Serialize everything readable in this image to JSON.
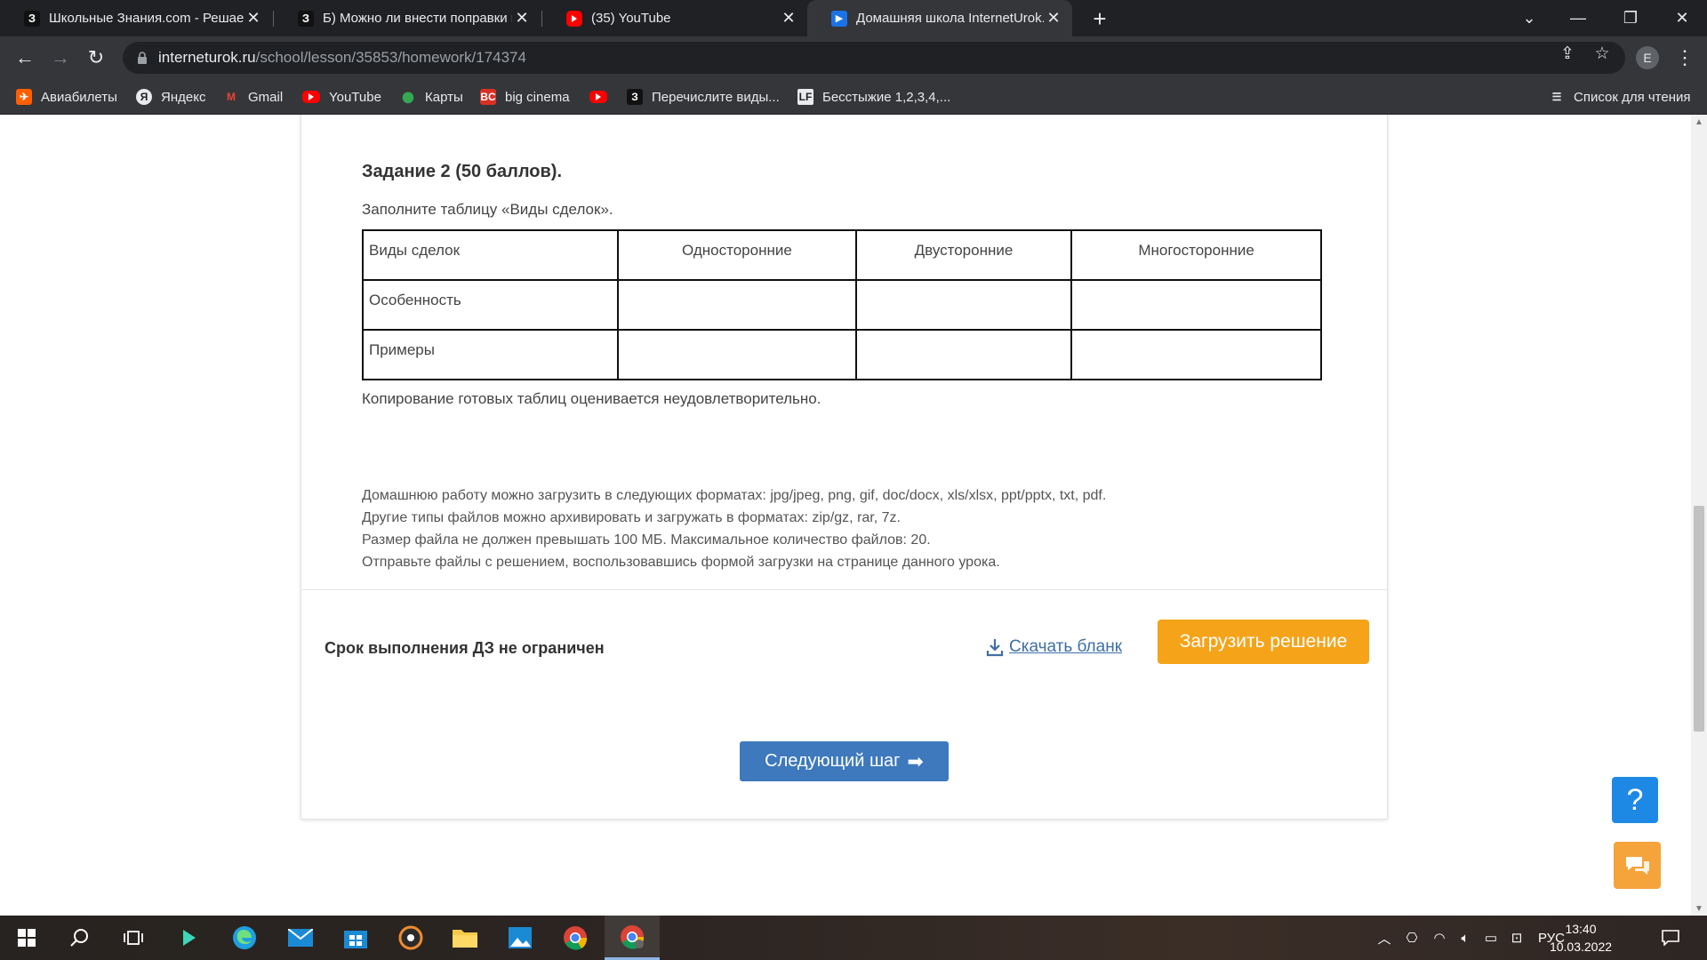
{
  "browser": {
    "tabs": [
      {
        "title": "Школьные Знания.com - Решае",
        "favicon": "znaniya-icon"
      },
      {
        "title": "Б) Можно ли внести поправки в",
        "favicon": "znaniya-icon"
      },
      {
        "title": "(35) YouTube",
        "favicon": "youtube-icon"
      },
      {
        "title": "Домашняя школа InternetUrok.r",
        "favicon": "interneturok-icon",
        "active": true
      }
    ],
    "url_host": "interneturok.ru",
    "url_path": "/school/lesson/35853/homework/174374",
    "profile_initial": "E",
    "bookmarks": [
      {
        "label": "Авиабилеты",
        "icon": "aviasales-icon"
      },
      {
        "label": "Яндекс",
        "icon": "yandex-icon"
      },
      {
        "label": "Gmail",
        "icon": "gmail-icon"
      },
      {
        "label": "YouTube",
        "icon": "youtube-icon"
      },
      {
        "label": "Карты",
        "icon": "maps-icon"
      },
      {
        "label": "big cinema",
        "icon": "bigcinema-icon"
      },
      {
        "label": "",
        "icon": "youtube-icon"
      },
      {
        "label": "Перечислите виды...",
        "icon": "znaniya-icon"
      },
      {
        "label": "Бесстыжие 1,2,3,4,...",
        "icon": "lostfilm-icon"
      }
    ],
    "reading_list": "Список для чтения"
  },
  "page": {
    "task_title": "Задание 2 (50 баллов).",
    "task_desc": "Заполните таблицу «Виды сделок».",
    "table": {
      "headers": [
        "Виды сделок",
        "Односторонние",
        "Двусторонние",
        "Многосторонние"
      ],
      "rows": [
        [
          "Особенность",
          "",
          "",
          ""
        ],
        [
          "Примеры",
          "",
          "",
          ""
        ]
      ]
    },
    "copy_note": "Копирование готовых таблиц оценивается неудовлетворительно.",
    "formats": [
      "Домашнюю работу можно загрузить в следующих форматах: jpg/jpeg, png, gif, doc/docx, xls/xlsx, ppt/pptx, txt, pdf.",
      "Другие типы файлов можно архивировать и загружать в форматах: zip/gz, rar, 7z.",
      "Размер файла не должен превышать 100 МБ. Максимальное количество файлов: 20.",
      "Отправьте файлы с решением, воспользовавшись формой загрузки на странице данного урока."
    ],
    "deadline": "Срок выполнения ДЗ не ограничен",
    "download_label": "Скачать бланк",
    "upload_label": "Загрузить решение",
    "next_label": "Следующий шаг",
    "help_label": "?"
  },
  "taskbar": {
    "lang": "РУС",
    "time": "13:40",
    "date": "10.03.2022"
  },
  "colors": {
    "accent_orange": "#f5a319",
    "accent_blue": "#3d79bc",
    "link": "#3f6fa5",
    "help_blue": "#1e88e5"
  }
}
